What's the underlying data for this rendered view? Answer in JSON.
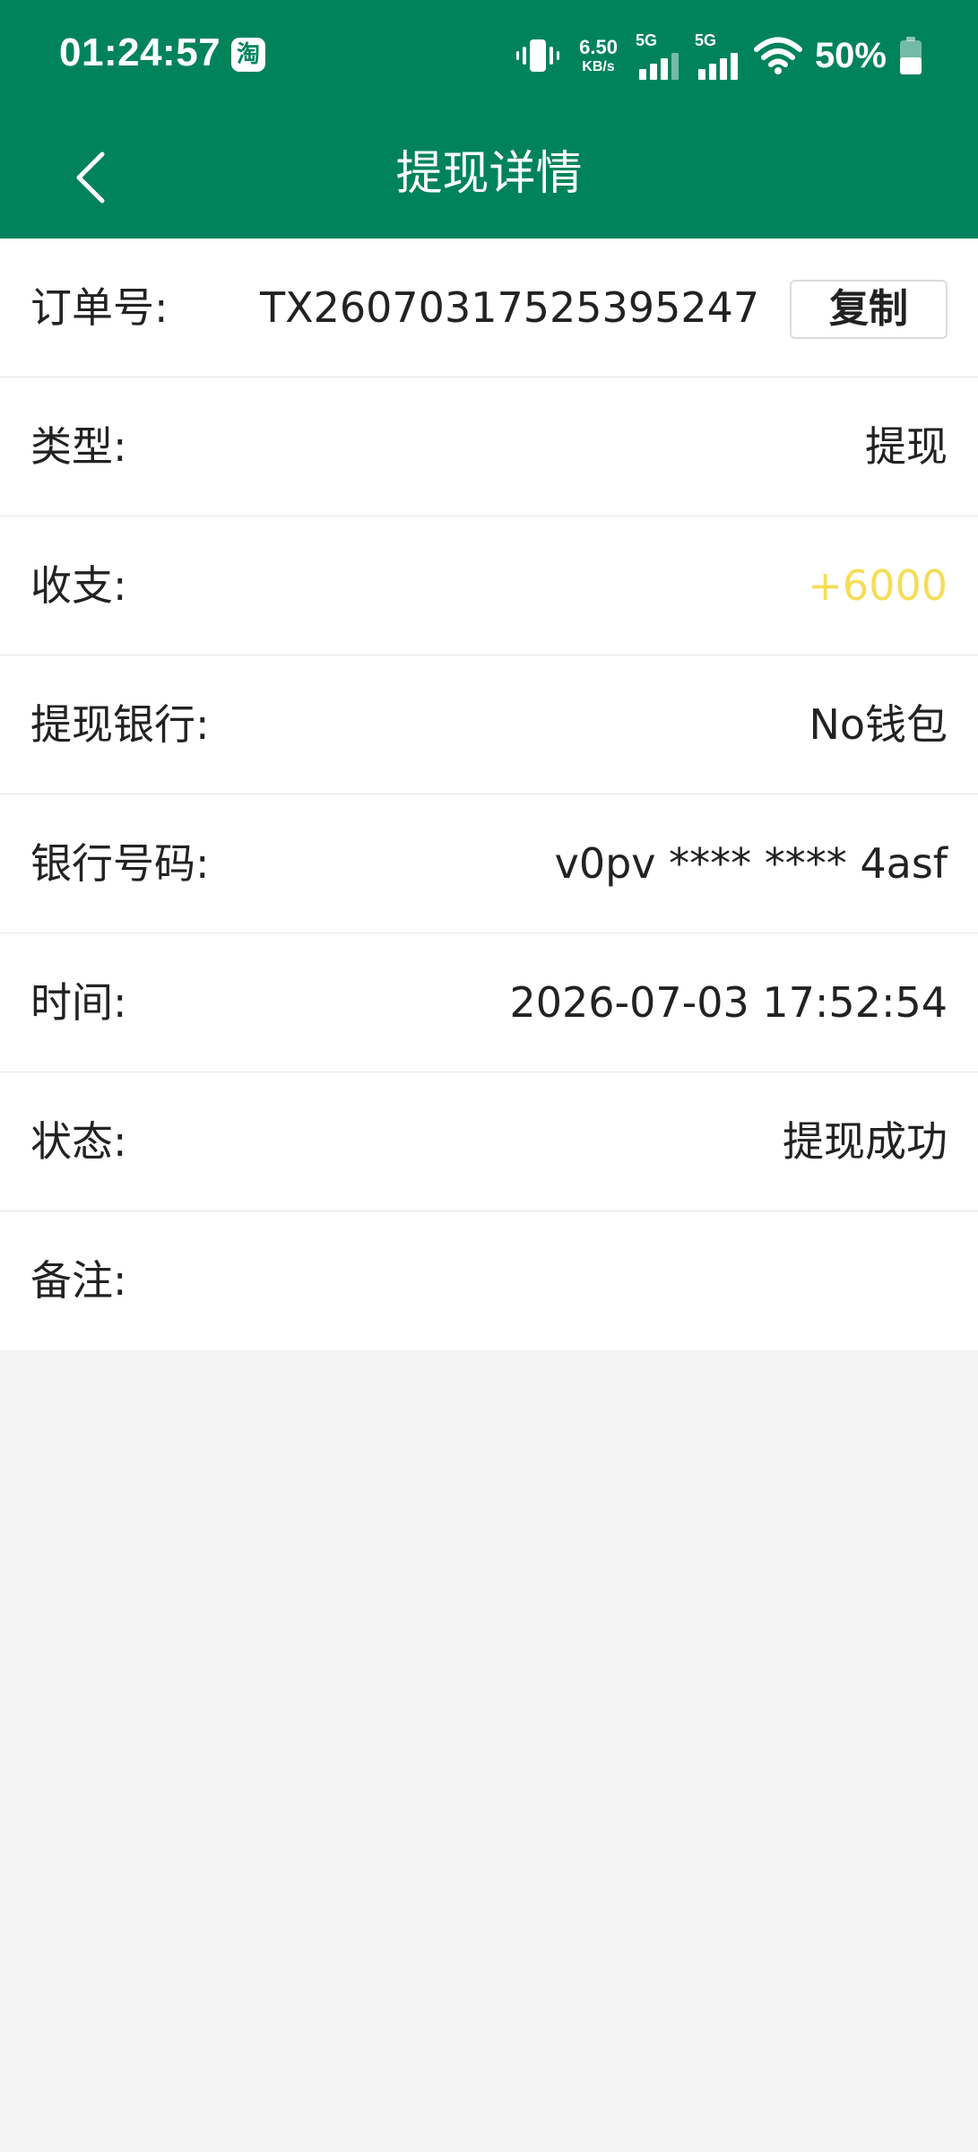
{
  "status_bar": {
    "time": "01:24:57",
    "taobao_icon_text": "淘",
    "net_speed_value": "6.50",
    "net_speed_unit": "KB/s",
    "sim1_label": "5G",
    "sim2_label": "5G",
    "battery_percent": "50%",
    "icons": [
      "taobao-app-icon",
      "vibrate-icon",
      "signal-icon",
      "wifi-icon",
      "battery-icon"
    ]
  },
  "header": {
    "title": "提现详情",
    "back_icon": "chevron-left-icon",
    "background_color": "#00835b"
  },
  "details": {
    "order": {
      "label": "订单号:",
      "value": "TX26070317525395247",
      "copy_label": "复制"
    },
    "type": {
      "label": "类型:",
      "value": "提现"
    },
    "amount": {
      "label": "收支:",
      "value": "+6000",
      "color": "#f5dd57"
    },
    "bank": {
      "label": "提现银行:",
      "value": "No钱包"
    },
    "account": {
      "label": "银行号码:",
      "value": "v0pv **** **** 4asf"
    },
    "time": {
      "label": "时间:",
      "value": "2026-07-03 17:52:54"
    },
    "status": {
      "label": "状态:",
      "value": "提现成功"
    },
    "remark": {
      "label": "备注:",
      "value": ""
    }
  }
}
